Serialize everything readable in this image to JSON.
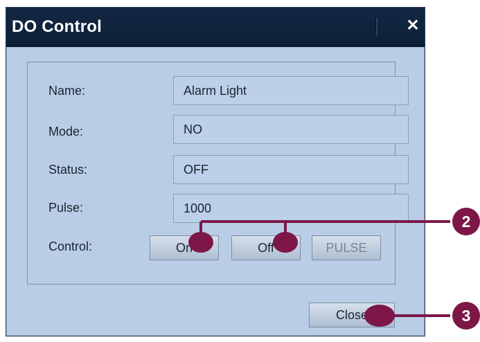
{
  "window": {
    "title": "DO Control",
    "close_glyph": "✕"
  },
  "form": {
    "name_label": "Name:",
    "name_value": "Alarm Light",
    "mode_label": "Mode:",
    "mode_value": "NO",
    "status_label": "Status:",
    "status_value": "OFF",
    "pulse_label": "Pulse:",
    "pulse_value": "1000",
    "control_label": "Control:",
    "on_label": "On",
    "off_label": "Off",
    "pulse_button_label": "PULSE"
  },
  "footer": {
    "close_label": "Close"
  },
  "callouts": {
    "color": "#7c1748",
    "badge_2": "2",
    "badge_3": "3"
  }
}
